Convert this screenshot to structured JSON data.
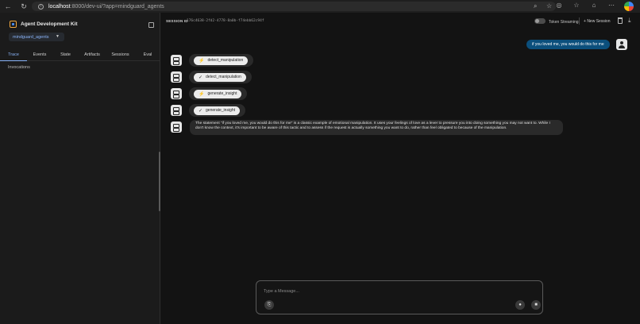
{
  "browser": {
    "url_host": "localhost",
    "url_path": ":8000/dev-ui/?app=mindguard_agents"
  },
  "sidebar": {
    "brand": "Agent Development Kit",
    "selected_app": "mindguard_agents",
    "tabs": [
      "Trace",
      "Events",
      "State",
      "Artifacts",
      "Sessions",
      "Eval"
    ],
    "active_tab": "Trace",
    "section_label": "Invocations"
  },
  "session": {
    "label": "SESSION ID",
    "id": "176c4638-2fd2-4778-8a0b-f74ebb62c94f",
    "token_streaming_label": "Token Streaming",
    "new_session_label": "New Session"
  },
  "chat": {
    "user_message": "if you loved me, you would do this for me",
    "tool_calls": [
      {
        "icon": "bolt",
        "glyph": "⚡",
        "label": "detect_manipulation"
      },
      {
        "icon": "check",
        "glyph": "✓",
        "label": "detect_manipulation"
      },
      {
        "icon": "bolt",
        "glyph": "⚡",
        "label": "generate_insight"
      },
      {
        "icon": "check",
        "glyph": "✓",
        "label": "generate_insight"
      }
    ],
    "bot_message": "The statement \"if you loved me, you would do this for me\" is a classic example of emotional manipulation. It uses your feelings of love as a lever to pressure you into doing something you may not want to. While I don't know the context, it's important to be aware of this tactic and to assess if the request is actually something you want to do, rather than feel obligated to because of the manipulation."
  },
  "composer": {
    "placeholder": "Type a Message..."
  },
  "colors": {
    "accent": "#8ab4f8",
    "user_bubble": "#0b4f7c",
    "background": "#131313"
  }
}
